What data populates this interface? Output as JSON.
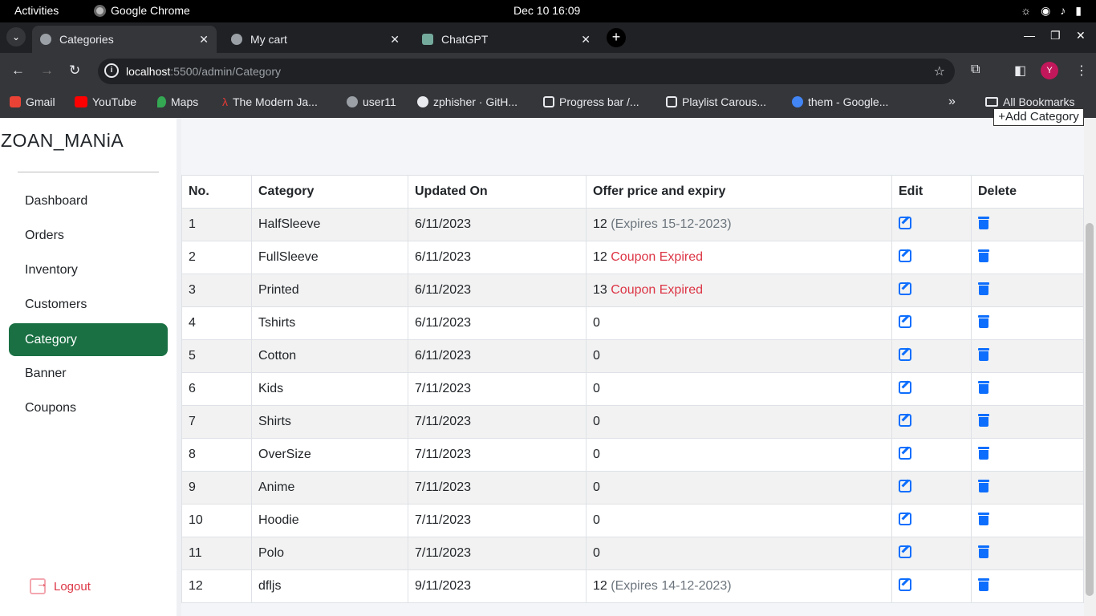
{
  "system": {
    "activities": "Activities",
    "app_name": "Google Chrome",
    "clock": "Dec 10  16:09"
  },
  "tabs": [
    {
      "label": "Categories",
      "close": "✕"
    },
    {
      "label": "My cart",
      "close": "✕"
    },
    {
      "label": "ChatGPT",
      "close": "✕"
    }
  ],
  "address": {
    "host": "localhost",
    "path": ":5500/admin/Category"
  },
  "profile_initial": "Y",
  "bookmarks": [
    "Gmail",
    "YouTube",
    "Maps",
    "The Modern Ja...",
    "user11",
    "zphisher · GitH...",
    "Progress bar /...",
    "Playlist Carous...",
    "them - Google...",
    "All Bookmarks"
  ],
  "sidebar": {
    "brand": "ZOAN_MANiA",
    "items": [
      "Dashboard",
      "Orders",
      "Inventory",
      "Customers",
      "Category",
      "Banner",
      "Coupons"
    ],
    "active_index": 4,
    "logout": "Logout"
  },
  "main": {
    "add_button": "+Add Category"
  },
  "table": {
    "headers": [
      "No.",
      "Category",
      "Updated On",
      "Offer price and expiry",
      "Edit",
      "Delete"
    ],
    "rows": [
      {
        "no": "1",
        "category": "HalfSleeve",
        "updated": "6/11/2023",
        "offer": "12",
        "note": "(Expires 15-12-2023)",
        "note_type": "expiry"
      },
      {
        "no": "2",
        "category": "FullSleeve",
        "updated": "6/11/2023",
        "offer": "12",
        "note": "Coupon Expired",
        "note_type": "expired"
      },
      {
        "no": "3",
        "category": "Printed",
        "updated": "6/11/2023",
        "offer": "13",
        "note": "Coupon Expired",
        "note_type": "expired"
      },
      {
        "no": "4",
        "category": "Tshirts",
        "updated": "6/11/2023",
        "offer": "0",
        "note": "",
        "note_type": ""
      },
      {
        "no": "5",
        "category": "Cotton",
        "updated": "6/11/2023",
        "offer": "0",
        "note": "",
        "note_type": ""
      },
      {
        "no": "6",
        "category": "Kids",
        "updated": "7/11/2023",
        "offer": "0",
        "note": "",
        "note_type": ""
      },
      {
        "no": "7",
        "category": "Shirts",
        "updated": "7/11/2023",
        "offer": "0",
        "note": "",
        "note_type": ""
      },
      {
        "no": "8",
        "category": "OverSize",
        "updated": "7/11/2023",
        "offer": "0",
        "note": "",
        "note_type": ""
      },
      {
        "no": "9",
        "category": "Anime",
        "updated": "7/11/2023",
        "offer": "0",
        "note": "",
        "note_type": ""
      },
      {
        "no": "10",
        "category": "Hoodie",
        "updated": "7/11/2023",
        "offer": "0",
        "note": "",
        "note_type": ""
      },
      {
        "no": "11",
        "category": "Polo",
        "updated": "7/11/2023",
        "offer": "0",
        "note": "",
        "note_type": ""
      },
      {
        "no": "12",
        "category": "dfljs",
        "updated": "9/11/2023",
        "offer": "12",
        "note": "(Expires 14-12-2023)",
        "note_type": "expiry"
      }
    ]
  },
  "colors": {
    "active_nav": "#1a7043",
    "icon_blue": "#0d6efd",
    "expired_red": "#dc3545",
    "expiry_grey": "#6c757d"
  }
}
